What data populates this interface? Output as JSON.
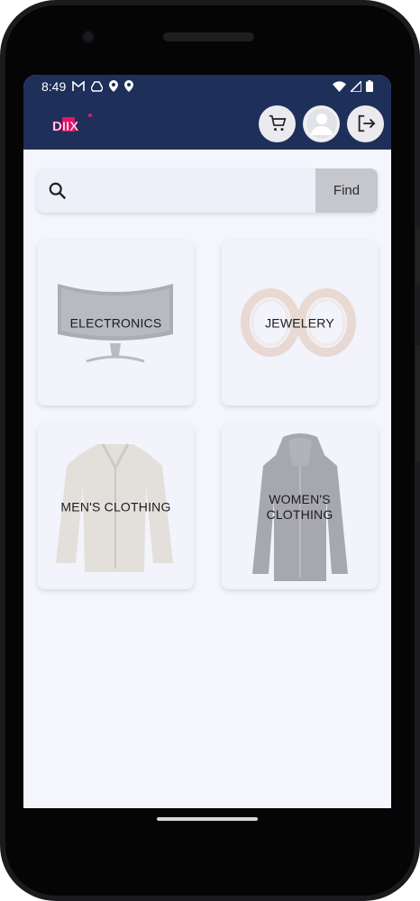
{
  "status_bar": {
    "time": "8:49",
    "left_icons": [
      "gmail-icon",
      "drive-icon",
      "location-icon",
      "location-icon"
    ],
    "right_icons": [
      "wifi-icon",
      "signal-icon",
      "battery-icon"
    ]
  },
  "app_bar": {
    "logo_text": "DIIX",
    "buttons": [
      "cart-icon",
      "profile-icon",
      "logout-icon"
    ],
    "color": "#1e2f59"
  },
  "search": {
    "placeholder": "",
    "value": "",
    "button_label": "Find"
  },
  "categories": [
    {
      "label": "ELECTRONICS",
      "image": "curved-monitor"
    },
    {
      "label": "JEWELERY",
      "image": "rings"
    },
    {
      "label": "MEN'S CLOTHING",
      "image": "men-jacket"
    },
    {
      "label": "WOMEN'S CLOTHING",
      "image": "women-hooded-jacket"
    }
  ]
}
